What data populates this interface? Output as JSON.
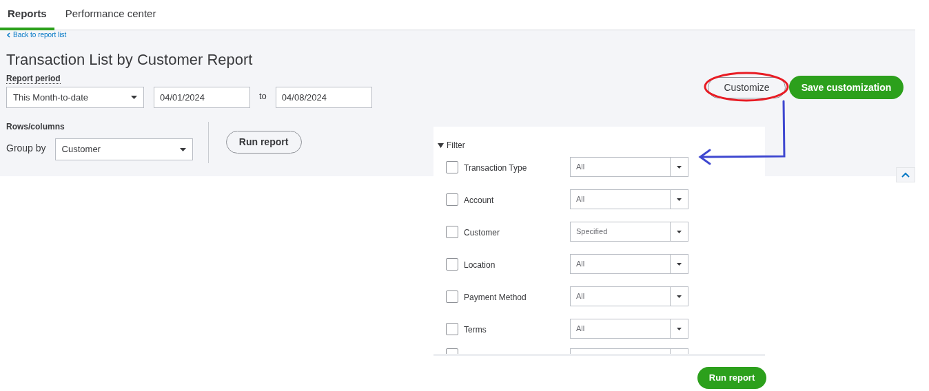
{
  "tabs": [
    {
      "label": "Reports",
      "selected": true
    },
    {
      "label": "Performance center",
      "selected": false
    }
  ],
  "back_link": "Back to report list",
  "title": "Transaction List by Customer Report",
  "report_period": {
    "label": "Report period",
    "period": "This Month-to-date",
    "from": "04/01/2024",
    "to_label": "to",
    "to": "04/08/2024"
  },
  "rows_columns": {
    "label": "Rows/columns",
    "group_by_label": "Group by",
    "group_by": "Customer",
    "run_button": "Run report"
  },
  "actions": {
    "customize": "Customize",
    "save": "Save customization"
  },
  "filter": {
    "title": "Filter",
    "expanded": true,
    "rows": [
      {
        "label": "Transaction Type",
        "checked": false,
        "value": "All"
      },
      {
        "label": "Account",
        "checked": false,
        "value": "All"
      },
      {
        "label": "Customer",
        "checked": false,
        "value": "Specified"
      },
      {
        "label": "Location",
        "checked": false,
        "value": "All"
      },
      {
        "label": "Payment Method",
        "checked": false,
        "value": "All"
      },
      {
        "label": "Terms",
        "checked": false,
        "value": "All"
      }
    ],
    "partial_row": {
      "checked": false
    }
  },
  "footer_button": "Run report"
}
